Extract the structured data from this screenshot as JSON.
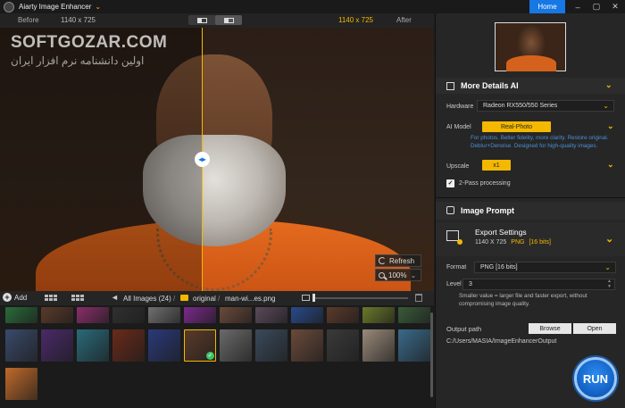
{
  "app": {
    "title": "Aiarty Image Enhancer",
    "home_label": "Home",
    "window_controls": [
      "minimize-icon",
      "maximize-icon",
      "close-icon"
    ]
  },
  "compare": {
    "before_label": "Before",
    "before_size": "1140 x 725",
    "after_size": "1140 x 725",
    "after_label": "After"
  },
  "watermark": {
    "latin": "SOFTGOZAR.COM",
    "persian": "اولین دانشنامه نرم افزار ایران"
  },
  "preview": {
    "refresh_label": "Refresh",
    "zoom_label": "100%",
    "zoom_arrow": "⌄"
  },
  "gallery": {
    "add_label": "Add",
    "breadcrumb": {
      "all_images": "All Images (24)",
      "sep": "/",
      "folder": "original",
      "file": "man-wi...es.png"
    },
    "back_glyph": "◄",
    "check_glyph": "✓",
    "thumb_colors": [
      "#2a6b3a",
      "#5a3a2a",
      "#8a2e6a",
      "#303030",
      "#707070",
      "#7a2a8a",
      "#6a4a3a",
      "#5a4a5a",
      "#2a4a8a",
      "#5a3a2a",
      "#6a7a2a",
      "#3a5a3a",
      "#3a4a6a",
      "#4a2a6a",
      "#2a6a7a",
      "#6a2a1a",
      "#2a3a7a",
      "#5a3a2a",
      "#6a6a6a",
      "#3a4a5a",
      "#6a4a3a",
      "#3a3a3a",
      "#9a8a7a",
      "#3a6a8a",
      "#c06a2a",
      "#2a5a6a"
    ]
  },
  "panel": {
    "more_details": {
      "title": "More Details AI",
      "hardware_label": "Hardware",
      "hardware_value": "Radeon RX550/550 Series",
      "ai_model_label": "AI Model",
      "ai_model_value": "Real-Photo",
      "ai_model_desc": "For photos. Better fidelity, more clarity. Restore original. Deblur+Denoise. Designed for high-quality images.",
      "upscale_label": "Upscale",
      "upscale_value": "x1",
      "two_pass_label": "2-Pass processing",
      "check_glyph": "✓"
    },
    "image_prompt": {
      "title": "Image Prompt"
    },
    "export": {
      "title": "Export Settings",
      "size": "1140 X 725",
      "format_short": "PNG",
      "bits": "[16 bits]",
      "format_label": "Format",
      "format_value": "PNG   [16 bits]",
      "level_label": "Level",
      "level_value": "3",
      "level_desc": "Smaller value = larger file and faster export, without compromising image quality.",
      "output_label": "Output path",
      "browse_label": "Browse",
      "open_label": "Open",
      "output_path": "C:/Users/MASIA/ImageEnhancerOutput"
    },
    "run_label": "RUN"
  },
  "colors": {
    "accent": "#f5b800",
    "primary": "#1677e5",
    "panel_bg": "#262626",
    "link_blue": "#4a90d9"
  }
}
